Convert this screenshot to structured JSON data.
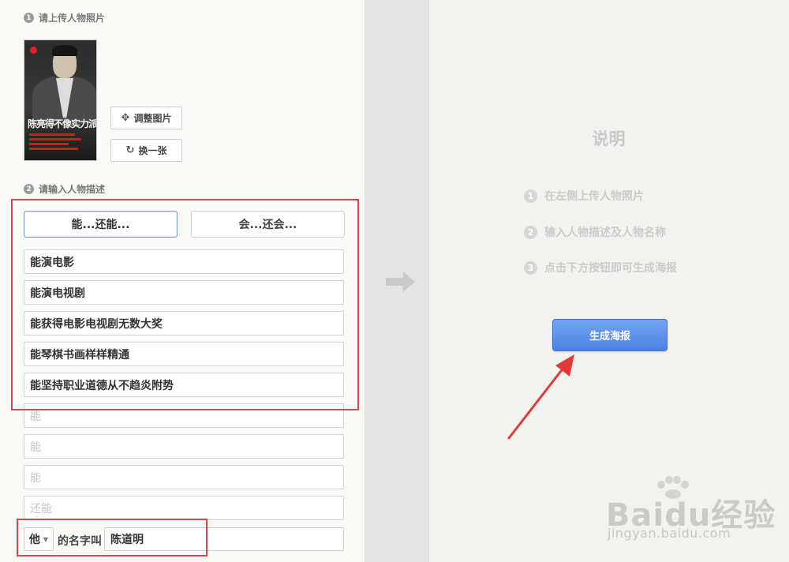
{
  "step1": {
    "num": "1",
    "label": "请上传人物照片"
  },
  "photo": {
    "poster_text": "陈亮得不像实力派"
  },
  "photo_actions": {
    "adjust_label": "调整图片",
    "replace_label": "换一张"
  },
  "step2": {
    "num": "2",
    "label": "请输入人物描述"
  },
  "modes": [
    {
      "label": "能...还能..."
    },
    {
      "label": "会...还会..."
    }
  ],
  "descriptions": [
    {
      "value": "能演电影",
      "placeholder": ""
    },
    {
      "value": "能演电视剧",
      "placeholder": ""
    },
    {
      "value": "能获得电影电视剧无数大奖",
      "placeholder": ""
    },
    {
      "value": "能琴棋书画样样精通",
      "placeholder": ""
    },
    {
      "value": "能坚持职业道德从不趋炎附势",
      "placeholder": ""
    },
    {
      "value": "",
      "placeholder": "能"
    },
    {
      "value": "",
      "placeholder": "能"
    },
    {
      "value": "",
      "placeholder": "能"
    },
    {
      "value": "",
      "placeholder": "还能"
    }
  ],
  "name_row": {
    "pronoun": "他",
    "label": "的名字叫",
    "name_value": "陈道明"
  },
  "instructions": {
    "title": "说明",
    "items": [
      {
        "num": "1",
        "text": "在左侧上传人物照片"
      },
      {
        "num": "2",
        "text": "输入人物描述及人物名称"
      },
      {
        "num": "3",
        "text": "点击下方按钮即可生成海报"
      }
    ]
  },
  "generate_button": {
    "label": "生成海报"
  },
  "watermark": {
    "brand": "Baidu经验",
    "url": "jingyan.baidu.com"
  },
  "colors": {
    "accent_blue": "#4a82e6",
    "highlight_red": "#d8474e",
    "panel_left": "#fbfaf7",
    "panel_right": "#f2f2ef"
  }
}
